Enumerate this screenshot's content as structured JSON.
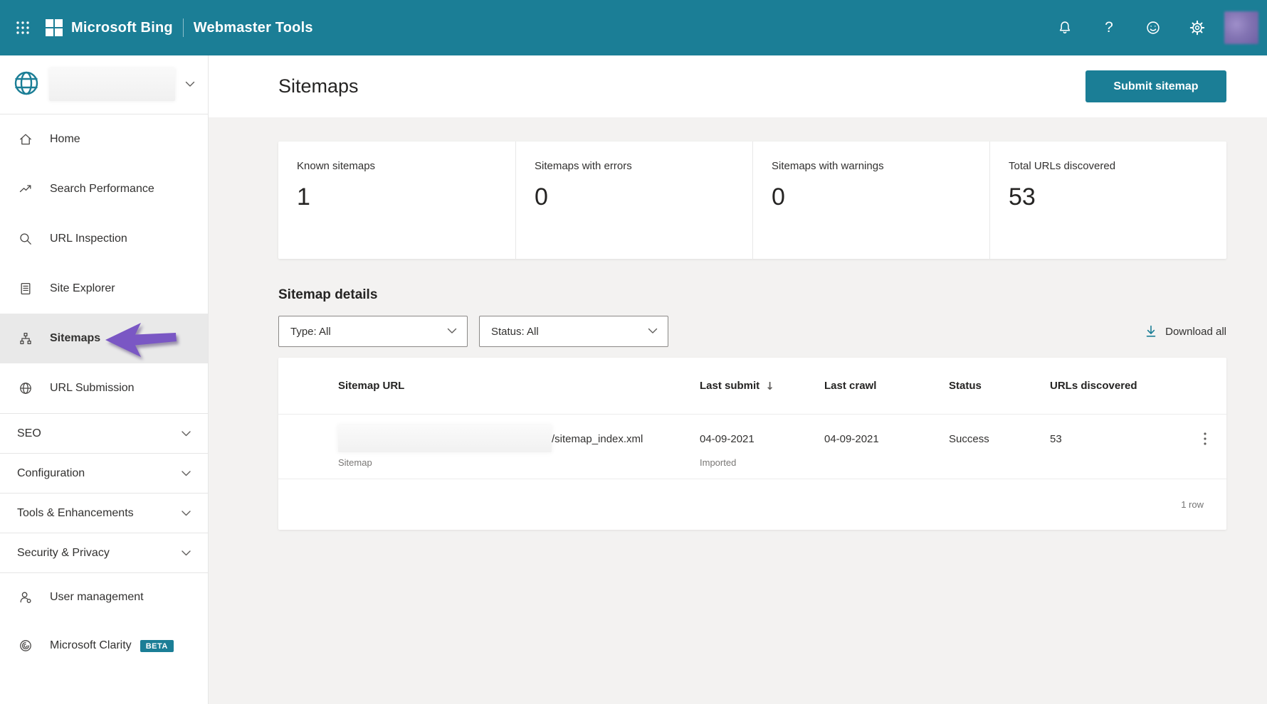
{
  "header": {
    "brand": "Microsoft Bing",
    "product": "Webmaster Tools"
  },
  "sidebar": {
    "items": [
      {
        "label": "Home",
        "icon": "home-icon"
      },
      {
        "label": "Search Performance",
        "icon": "trend-icon"
      },
      {
        "label": "URL Inspection",
        "icon": "magnifier-icon"
      },
      {
        "label": "Site Explorer",
        "icon": "document-icon"
      },
      {
        "label": "Sitemaps",
        "icon": "sitemap-icon",
        "selected": true
      },
      {
        "label": "URL Submission",
        "icon": "globe-icon"
      }
    ],
    "sections": [
      {
        "label": "SEO"
      },
      {
        "label": "Configuration"
      },
      {
        "label": "Tools & Enhancements"
      },
      {
        "label": "Security & Privacy"
      }
    ],
    "footer_items": [
      {
        "label": "User management",
        "icon": "person-icon"
      },
      {
        "label": "Microsoft Clarity",
        "icon": "clarity-icon",
        "badge": "BETA"
      }
    ]
  },
  "page": {
    "title": "Sitemaps",
    "submit_button": "Submit sitemap"
  },
  "stats": [
    {
      "label": "Known sitemaps",
      "value": "1"
    },
    {
      "label": "Sitemaps with errors",
      "value": "0"
    },
    {
      "label": "Sitemaps with warnings",
      "value": "0"
    },
    {
      "label": "Total URLs discovered",
      "value": "53"
    }
  ],
  "details": {
    "heading": "Sitemap details",
    "filters": [
      {
        "value": "Type: All"
      },
      {
        "value": "Status: All"
      }
    ],
    "download_all": "Download all"
  },
  "table": {
    "columns": [
      "Sitemap URL",
      "Last submit",
      "Last crawl",
      "Status",
      "URLs discovered"
    ],
    "sort_column": "Last submit",
    "sort_direction": "descending",
    "rows": [
      {
        "url_suffix": "/sitemap_index.xml",
        "type_label": "Sitemap",
        "last_submit": "04-09-2021",
        "submit_note": "Imported",
        "last_crawl": "04-09-2021",
        "status": "Success",
        "urls_discovered": "53"
      }
    ],
    "footer": "1 row"
  },
  "colors": {
    "accent_teal": "#1b7e96",
    "annotation_purple": "#7a57c4",
    "selected_item_bg": "#e9e9e9",
    "page_bg": "#f3f2f1"
  }
}
